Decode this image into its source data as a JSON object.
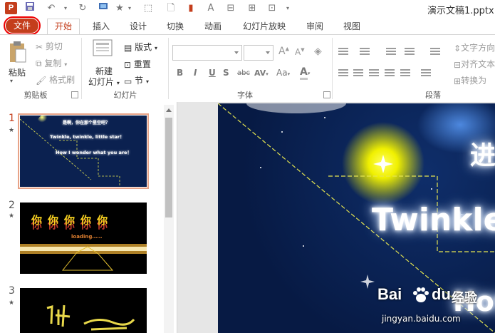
{
  "window": {
    "title": "演示文稿1.pptx",
    "app_icon": "P"
  },
  "tabs": [
    {
      "label": "文件"
    },
    {
      "label": "开始"
    },
    {
      "label": "插入"
    },
    {
      "label": "设计"
    },
    {
      "label": "切换"
    },
    {
      "label": "动画"
    },
    {
      "label": "幻灯片放映"
    },
    {
      "label": "审阅"
    },
    {
      "label": "视图"
    }
  ],
  "ribbon": {
    "clipboard": {
      "label": "剪贴板",
      "paste": "粘贴",
      "cut": "剪切",
      "copy": "复制",
      "format_painter": "格式刷"
    },
    "slides": {
      "label": "幻灯片",
      "new_slide_1": "新建",
      "new_slide_2": "幻灯片",
      "layout": "版式",
      "reset": "重置",
      "section": "节"
    },
    "font": {
      "label": "字体",
      "bold": "B",
      "italic": "I",
      "underline": "U",
      "shadow": "S",
      "strike": "abc",
      "spacing": "AV",
      "case": "Aa",
      "grow": "A",
      "shrink": "A"
    },
    "paragraph": {
      "label": "段落",
      "text_direction": "文字方向",
      "align_text": "对齐文本",
      "convert": "转换为"
    }
  },
  "slides_panel": {
    "slides": [
      {
        "number": "1",
        "star": "★",
        "text_1": "是啊，你在那个星空吧？",
        "text_2": "Twinkle, twinkle, little star！",
        "text_3": "How I wonder what you are！"
      },
      {
        "number": "2",
        "star": "★",
        "chars": [
          "你",
          "你",
          "你",
          "你",
          "你"
        ],
        "loading": "loading……"
      },
      {
        "number": "3",
        "star": "★"
      }
    ]
  },
  "main_slide": {
    "line_1": "Twinkle",
    "line_2": "How",
    "corner": "进"
  },
  "watermark": {
    "brand": "Bai",
    "brand2": "du",
    "sub": "经验",
    "url": "jingyan.baidu.com"
  }
}
